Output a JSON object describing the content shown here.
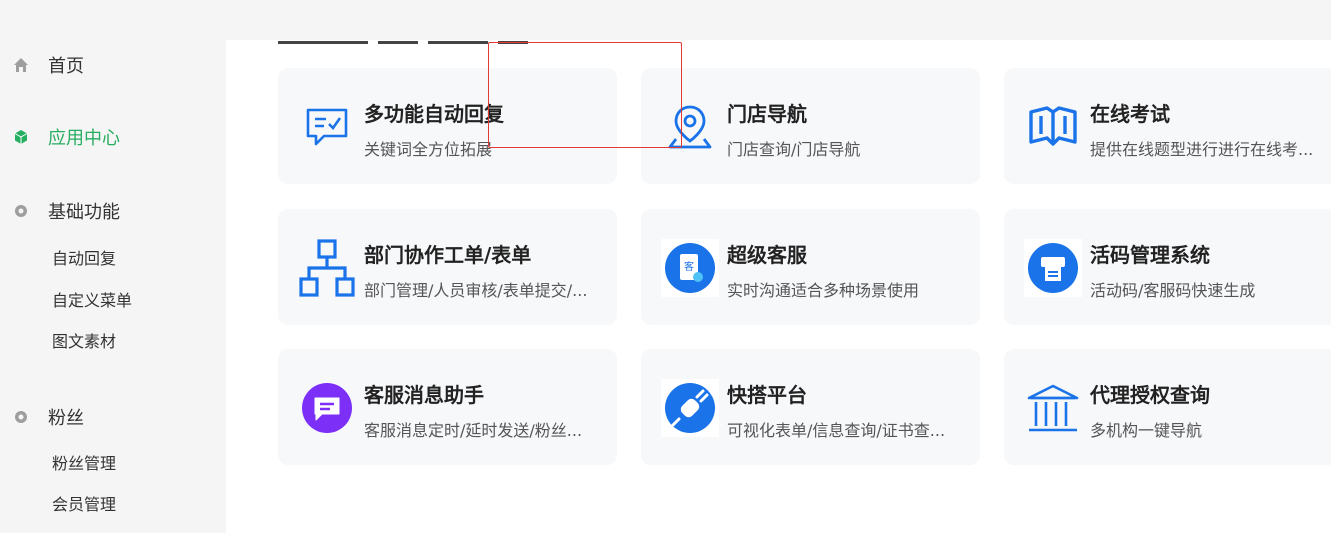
{
  "sidebar": {
    "home": {
      "label": "首页",
      "icon": "home-icon"
    },
    "app_center": {
      "label": "应用中心",
      "icon": "cube-icon",
      "active_color": "#27ae60"
    },
    "basic": {
      "label": "基础功能",
      "icon": "gear-icon",
      "items": [
        "自动回复",
        "自定义菜单",
        "图文素材"
      ]
    },
    "fans": {
      "label": "粉丝",
      "icon": "gear-icon",
      "items": [
        "粉丝管理",
        "会员管理"
      ]
    }
  },
  "cards": [
    {
      "title": "多功能自动回复",
      "desc": "关键词全方位拓展",
      "icon": "chat-check-icon"
    },
    {
      "title": "门店导航",
      "desc": "门店查询/门店导航",
      "icon": "location-pin-icon"
    },
    {
      "title": "在线考试",
      "desc": "提供在线题型进行进行在线考...",
      "icon": "open-book-icon"
    },
    {
      "title": "部门协作工单/表单",
      "desc": "部门管理/人员审核/表单提交/...",
      "icon": "org-chart-icon"
    },
    {
      "title": "超级客服",
      "desc": "实时沟通适合多种场景使用",
      "icon": "customer-service-icon"
    },
    {
      "title": "活码管理系统",
      "desc": "活动码/客服码快速生成",
      "icon": "printer-icon"
    },
    {
      "title": "客服消息助手",
      "desc": "客服消息定时/延时发送/粉丝...",
      "icon": "message-icon"
    },
    {
      "title": "快搭平台",
      "desc": "可视化表单/信息查询/证书查...",
      "icon": "plug-icon"
    },
    {
      "title": "代理授权查询",
      "desc": "多机构一键导航",
      "icon": "bank-icon"
    }
  ],
  "colors": {
    "brand_blue": "#1a73e8",
    "highlight": "#e53935",
    "purple": "#7b2ff7"
  }
}
